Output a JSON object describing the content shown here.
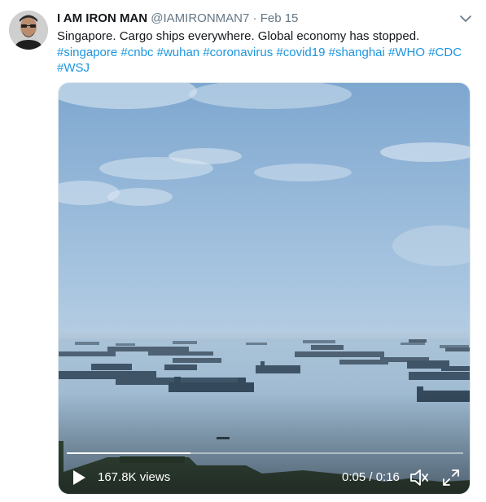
{
  "tweet": {
    "author_name": "I AM IRON MAN",
    "handle": "@IAMIRONMAN7",
    "separator": "·",
    "date": "Feb 15",
    "text": "Singapore. Cargo ships everywhere. Global economy has stopped.",
    "hashtags": [
      "#singapore",
      "#cnbc",
      "#wuhan",
      "#coronavirus",
      "#covid19",
      "#shanghai",
      "#WHO",
      "#CDC",
      "#WSJ"
    ]
  },
  "video": {
    "views": "167.8K views",
    "time": "0:05 / 0:16",
    "progress_fraction": 0.3125
  },
  "icons": {
    "caret": "chevron-down-icon",
    "play": "play-icon",
    "volume": "volume-icon",
    "fullscreen": "fullscreen-icon"
  },
  "colors": {
    "link": "#1b95e0",
    "muted": "#657786",
    "text": "#14171a"
  }
}
